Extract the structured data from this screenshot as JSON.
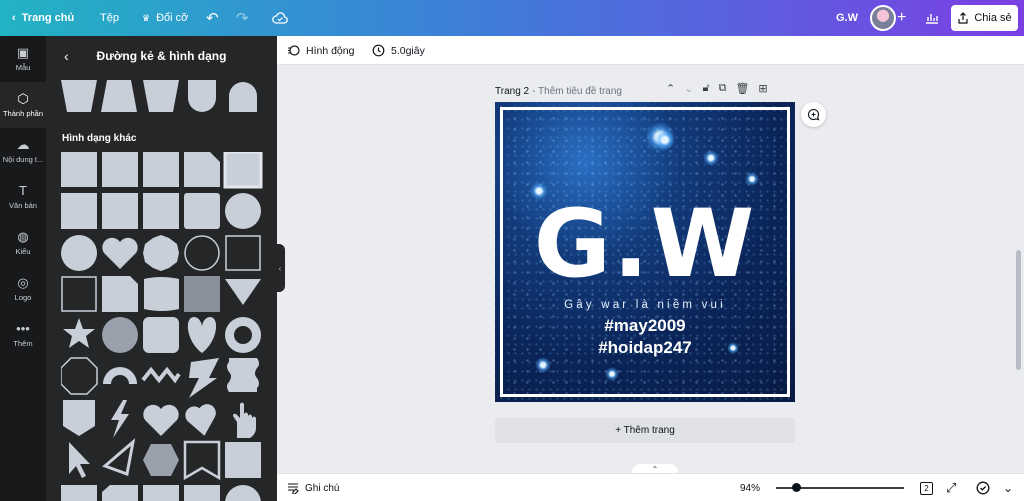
{
  "topbar": {
    "back_label": "Trang chủ",
    "file_label": "Tệp",
    "resize_label": "Đổi cỡ",
    "doc_name": "G.W",
    "share_label": "Chia sẻ",
    "icons": [
      "chevron-left-icon",
      "crown-icon",
      "undo-icon",
      "redo-icon",
      "cloud-icon",
      "plus-icon",
      "insights-icon",
      "share-icon"
    ]
  },
  "rail": {
    "items": [
      {
        "label": "Mẫu",
        "icon": "template-icon"
      },
      {
        "label": "Thành phần",
        "icon": "elements-icon"
      },
      {
        "label": "Nội dung t...",
        "icon": "upload-icon"
      },
      {
        "label": "Văn bản",
        "icon": "text-icon"
      },
      {
        "label": "Kiểu",
        "icon": "palette-icon"
      },
      {
        "label": "Logo",
        "icon": "logo-icon"
      },
      {
        "label": "Thêm",
        "icon": "more-icon"
      }
    ]
  },
  "panel": {
    "title": "Đường kẻ & hình dạng",
    "section_title": "Hình dạng khác"
  },
  "subbar": {
    "animate_label": "Hình động",
    "duration_label": "5.0giây"
  },
  "page": {
    "title": "Trang 2",
    "subtitle": "- Thêm tiêu đề trang",
    "add_page_label": "+ Thêm trang"
  },
  "design": {
    "title": "G.W",
    "subtitle": "Gây war là niềm vui",
    "tag1": "#may2009",
    "tag2": "#hoidap247"
  },
  "bottombar": {
    "notes_label": "Ghi chú",
    "zoom": "94%",
    "page_count": "2"
  },
  "colors": {
    "topbar_start": "#22b3c4",
    "topbar_end": "#7b3fe4",
    "panel_bg": "#252627",
    "rail_bg": "#18191b",
    "canvas_bg": "#ebecf0"
  }
}
